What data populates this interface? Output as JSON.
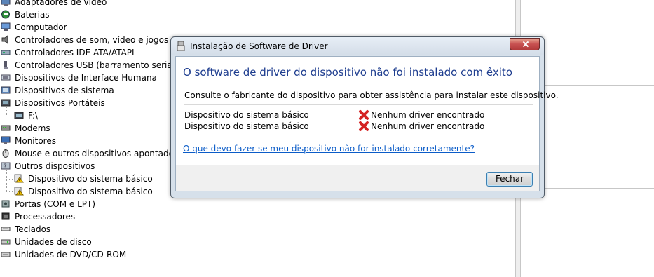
{
  "device_tree": {
    "items": [
      {
        "label": "Adaptadores de vídeo",
        "icon": "display-adapter-icon",
        "level": 0
      },
      {
        "label": "Baterias",
        "icon": "battery-icon",
        "level": 0
      },
      {
        "label": "Computador",
        "icon": "computer-icon",
        "level": 0
      },
      {
        "label": "Controladores de som, vídeo e jogos",
        "icon": "speaker-icon",
        "level": 0
      },
      {
        "label": "Controladores IDE ATA/ATAPI",
        "icon": "ide-controller-icon",
        "level": 0
      },
      {
        "label": "Controladores USB (barramento serial univ",
        "icon": "usb-icon",
        "level": 0
      },
      {
        "label": "Dispositivos de Interface Humana",
        "icon": "hid-icon",
        "level": 0
      },
      {
        "label": "Dispositivos de sistema",
        "icon": "system-device-icon",
        "level": 0
      },
      {
        "label": "Dispositivos Portáteis",
        "icon": "portable-device-icon",
        "level": 0
      },
      {
        "label": "F:\\",
        "icon": "portable-drive-icon",
        "level": 1
      },
      {
        "label": "Modems",
        "icon": "modem-icon",
        "level": 0
      },
      {
        "label": "Monitores",
        "icon": "monitor-icon",
        "level": 0
      },
      {
        "label": "Mouse e outros dispositivos apontadores",
        "icon": "mouse-icon",
        "level": 0
      },
      {
        "label": "Outros dispositivos",
        "icon": "other-devices-icon",
        "level": 0
      },
      {
        "label": "Dispositivo do sistema básico",
        "icon": "warning-device-icon",
        "level": 1
      },
      {
        "label": "Dispositivo do sistema básico",
        "icon": "warning-device-icon",
        "level": 1
      },
      {
        "label": "Portas (COM e LPT)",
        "icon": "port-icon",
        "level": 0
      },
      {
        "label": "Processadores",
        "icon": "processor-icon",
        "level": 0
      },
      {
        "label": "Teclados",
        "icon": "keyboard-icon",
        "level": 0
      },
      {
        "label": "Unidades de disco",
        "icon": "disk-drive-icon",
        "level": 0
      },
      {
        "label": "Unidades de DVD/CD-ROM",
        "icon": "dvd-drive-icon",
        "level": 0
      }
    ]
  },
  "dialog": {
    "title": "Instalação de Software de Driver",
    "headline": "O software de driver do dispositivo não foi instalado com êxito",
    "description": "Consulte o fabricante do dispositivo para obter assistência para instalar este dispositivo.",
    "devices": [
      {
        "name": "Dispositivo do sistema básico",
        "status": "Nenhum driver encontrado",
        "status_icon": "error-x-icon"
      },
      {
        "name": "Dispositivo do sistema básico",
        "status": "Nenhum driver encontrado",
        "status_icon": "error-x-icon"
      }
    ],
    "help_link": "O que devo fazer se meu dispositivo não for instalado corretamente?",
    "close_button": "Fechar"
  },
  "colors": {
    "headline": "#1e3d8f",
    "link": "#0b5cc8",
    "error": "#d42222",
    "close_button": "#c75050"
  }
}
